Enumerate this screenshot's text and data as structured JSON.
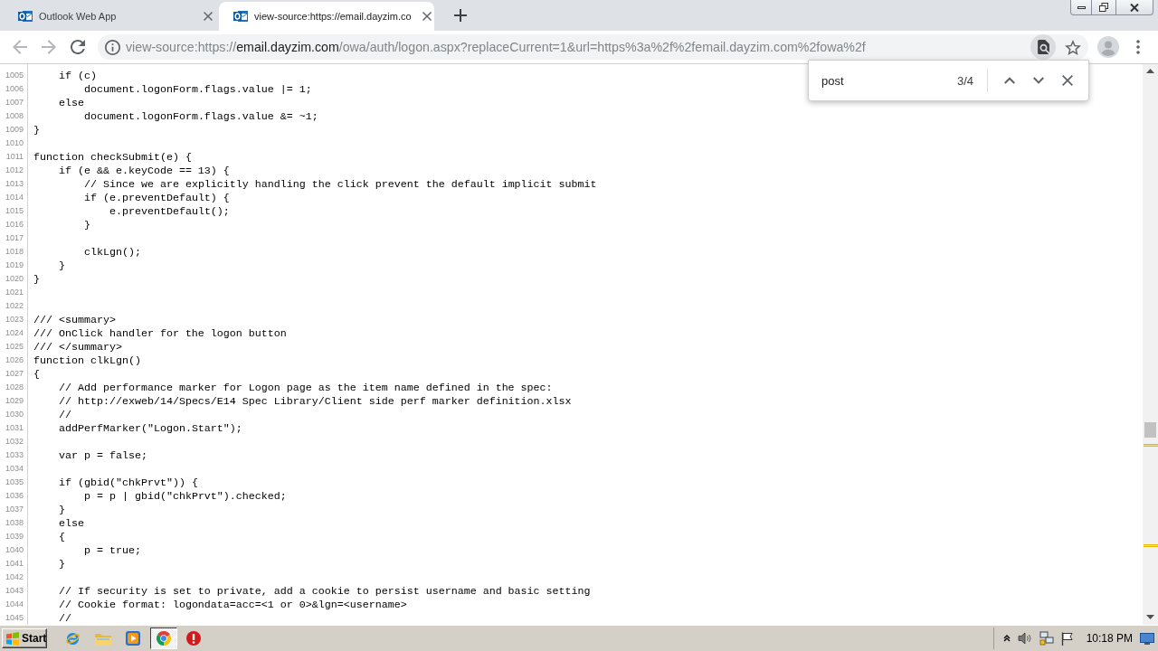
{
  "tab_strip": {
    "tabs": [
      {
        "title": "Outlook Web App",
        "selected": false
      },
      {
        "title": "view-source:https://email.dayzim.co",
        "selected": true
      }
    ]
  },
  "toolbar": {
    "nav_buttons": [
      {
        "kind": "back",
        "disabled": true
      },
      {
        "kind": "forward",
        "disabled": true
      },
      {
        "kind": "reload",
        "disabled": false
      }
    ],
    "address": {
      "scheme": "view-source:https://",
      "host": "email.dayzim.com",
      "path": "/owa/auth/logon.aspx?replaceCurrent=1&url=https%3a%2f%2femail.dayzim.com%2fowa%2f"
    },
    "find_in_page_active": true
  },
  "find_bar": {
    "query": "post",
    "match_count": "3/4"
  },
  "source": {
    "lines": [
      {
        "number": "1005",
        "text": "    if (c)"
      },
      {
        "number": "1006",
        "text": "        document.logonForm.flags.value |= 1;"
      },
      {
        "number": "1007",
        "text": "    else"
      },
      {
        "number": "1008",
        "text": "        document.logonForm.flags.value &= ~1;"
      },
      {
        "number": "1009",
        "text": "}"
      },
      {
        "number": "1010"
      },
      {
        "number": "1011",
        "text": "function checkSubmit(e) {"
      },
      {
        "number": "1012",
        "text": "    if (e && e.keyCode == 13) {"
      },
      {
        "number": "1013",
        "text": "        // Since we are explicitly handling the click prevent the default implicit submit"
      },
      {
        "number": "1014",
        "text": "        if (e.preventDefault) {"
      },
      {
        "number": "1015",
        "text": "            e.preventDefault();"
      },
      {
        "number": "1016",
        "text": "        }"
      },
      {
        "number": "1017"
      },
      {
        "number": "1018",
        "text": "        clkLgn();"
      },
      {
        "number": "1019",
        "text": "    }"
      },
      {
        "number": "1020",
        "text": "}"
      },
      {
        "number": "1021"
      },
      {
        "number": "1022"
      },
      {
        "number": "1023",
        "text": "/// <summary>"
      },
      {
        "number": "1024",
        "text": "/// OnClick handler for the logon button"
      },
      {
        "number": "1025",
        "text": "/// </summary>"
      },
      {
        "number": "1026",
        "text": "function clkLgn()"
      },
      {
        "number": "1027",
        "text": "{"
      },
      {
        "number": "1028",
        "text": "    // Add performance marker for Logon page as the item name defined in the spec:"
      },
      {
        "number": "1029",
        "text": "    // http://exweb/14/Specs/E14 Spec Library/Client side perf marker definition.xlsx"
      },
      {
        "number": "1030",
        "text": "    //"
      },
      {
        "number": "1031",
        "text": "    addPerfMarker(\"Logon.Start\");"
      },
      {
        "number": "1032"
      },
      {
        "number": "1033",
        "text": "    var p = false;"
      },
      {
        "number": "1034"
      },
      {
        "number": "1035",
        "text": "    if (gbid(\"chkPrvt\")) {"
      },
      {
        "number": "1036",
        "text": "        p = p | gbid(\"chkPrvt\").checked;"
      },
      {
        "number": "1037",
        "text": "    }"
      },
      {
        "number": "1038",
        "text": "    else"
      },
      {
        "number": "1039",
        "text": "    {"
      },
      {
        "number": "1040",
        "text": "        p = true;"
      },
      {
        "number": "1041",
        "text": "    }"
      },
      {
        "number": "1042"
      },
      {
        "number": "1043",
        "text": "    // If security is set to private, add a cookie to persist username and basic setting"
      },
      {
        "number": "1044",
        "text": "    // Cookie format: logondata=acc=<1 or 0>&lgn=<username>"
      },
      {
        "number": "1045",
        "text": "    //"
      }
    ]
  },
  "taskbar": {
    "start_label": "Start",
    "apps": [
      {
        "kind": "globe",
        "selected": false
      },
      {
        "kind": "folder",
        "selected": false
      },
      {
        "kind": "player",
        "selected": false
      },
      {
        "kind": "wheel",
        "selected": true
      },
      {
        "kind": "alert",
        "selected": false
      }
    ],
    "clock": "10:18 PM"
  }
}
